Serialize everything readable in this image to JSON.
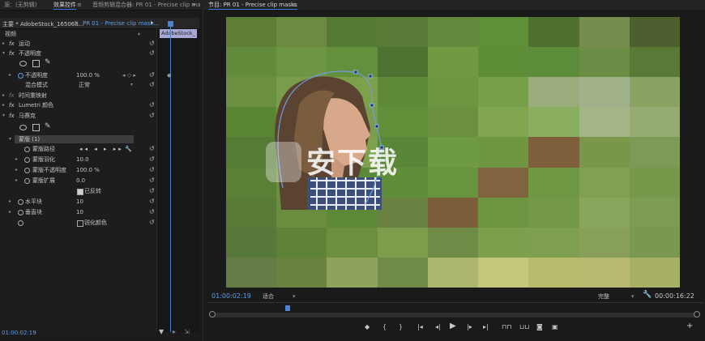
{
  "tabs": {
    "source_label": "源：(无剪辑)",
    "effect_controls_label": "效果控件",
    "audio_mixer_label": "音频剪辑混合器: PR 01 - Precise clip ma",
    "program_label": "节目: PR 01 - Precise clip masks",
    "menu_icon": "≡",
    "overflow_icon": "»"
  },
  "effect_controls": {
    "master_clip": "主要 * AdobeStock_165068...",
    "sequence_clip": "PR 01 - Precise clip mask...",
    "timeline_clip_tooltip": "AdobeStock_",
    "section_video": "视频",
    "motion": "运动",
    "opacity": "不透明度",
    "opacity_prop": "不透明度",
    "opacity_value": "100.0 %",
    "blend_mode_label": "混合模式",
    "blend_mode_value": "正常",
    "time_remap": "时间重映射",
    "lumetri": "Lumetri 颜色",
    "mosaic": "马赛克",
    "mask_name": "蒙版 (1)",
    "mask_path": "蒙版路径",
    "mask_feather": "蒙版羽化",
    "mask_feather_value": "10.0",
    "mask_opacity": "蒙版不透明度",
    "mask_opacity_value": "100.0 %",
    "mask_expansion": "蒙版扩展",
    "mask_expansion_value": "0.0",
    "inverted_label": "已反转",
    "horizontal_blocks": "水平块",
    "horizontal_blocks_value": "10",
    "vertical_blocks": "垂直块",
    "vertical_blocks_value": "10",
    "sharpen_colors": "锐化颜色",
    "timecode": "01:00:02:19",
    "inverted_checked": true,
    "sharpen_checked": false
  },
  "program_monitor": {
    "timecode": "01:00:02:19",
    "fit_label": "适合",
    "quality_label": "完整",
    "duration": "00:00:16:22",
    "watermark_text": "安下载"
  },
  "icons": {
    "reset": "reset-icon",
    "stopwatch": "stopwatch-icon",
    "pen": "pen-icon",
    "wrench": "wrench-icon"
  },
  "colors": {
    "accent": "#4a82d4",
    "blue_value": "#5f9ee6",
    "mosaic": [
      [
        "#5e7e36",
        "#6d8a41",
        "#557a33",
        "#5a7a38",
        "#62893c",
        "#5f8f37",
        "#4f7030",
        "#758c4d",
        "#4e5f2f"
      ],
      [
        "#628c3c",
        "#6d9545",
        "#63903d",
        "#4e7231",
        "#6f9a43",
        "#5f8e39",
        "#5d8d3b",
        "#6b8c45",
        "#587a36"
      ],
      [
        "#6a8f40",
        "#789c4a",
        "#7da04b",
        "#5f8a3a",
        "#6c9541",
        "#76a048",
        "#9aab7c",
        "#a1b28a",
        "#8aa262"
      ],
      [
        "#5a8634",
        "#739a44",
        "#7a9b4d",
        "#628f3a",
        "#6b9140",
        "#7fa54f",
        "#8aae60",
        "#a3b486",
        "#96aa73"
      ],
      [
        "#547c34",
        "#6a9140",
        "#7da14d",
        "#5a8638",
        "#6f9a44",
        "#6f9741",
        "#805f3d",
        "#7a9749",
        "#7e9a57"
      ],
      [
        "#598035",
        "#6a9040",
        "#5c8a39",
        "#5f8d3a",
        "#68943f",
        "#80643f",
        "#6f9844",
        "#82a052",
        "#76984a"
      ],
      [
        "#587c36",
        "#6a8c3e",
        "#5d8939",
        "#6b8243",
        "#7b5f3b",
        "#6d9440",
        "#739948",
        "#89a65c",
        "#7c9d51"
      ],
      [
        "#56783a",
        "#5e8238",
        "#6b8f3f",
        "#7d9d4c",
        "#6f8b45",
        "#7b9f4d",
        "#7e9f4f",
        "#879f58",
        "#7a9850"
      ],
      [
        "#667c46",
        "#6a8240",
        "#8fa25c",
        "#6f8b45",
        "#acb66e",
        "#c4c679",
        "#b8bb6c",
        "#b9ba72",
        "#a8b065"
      ]
    ]
  }
}
